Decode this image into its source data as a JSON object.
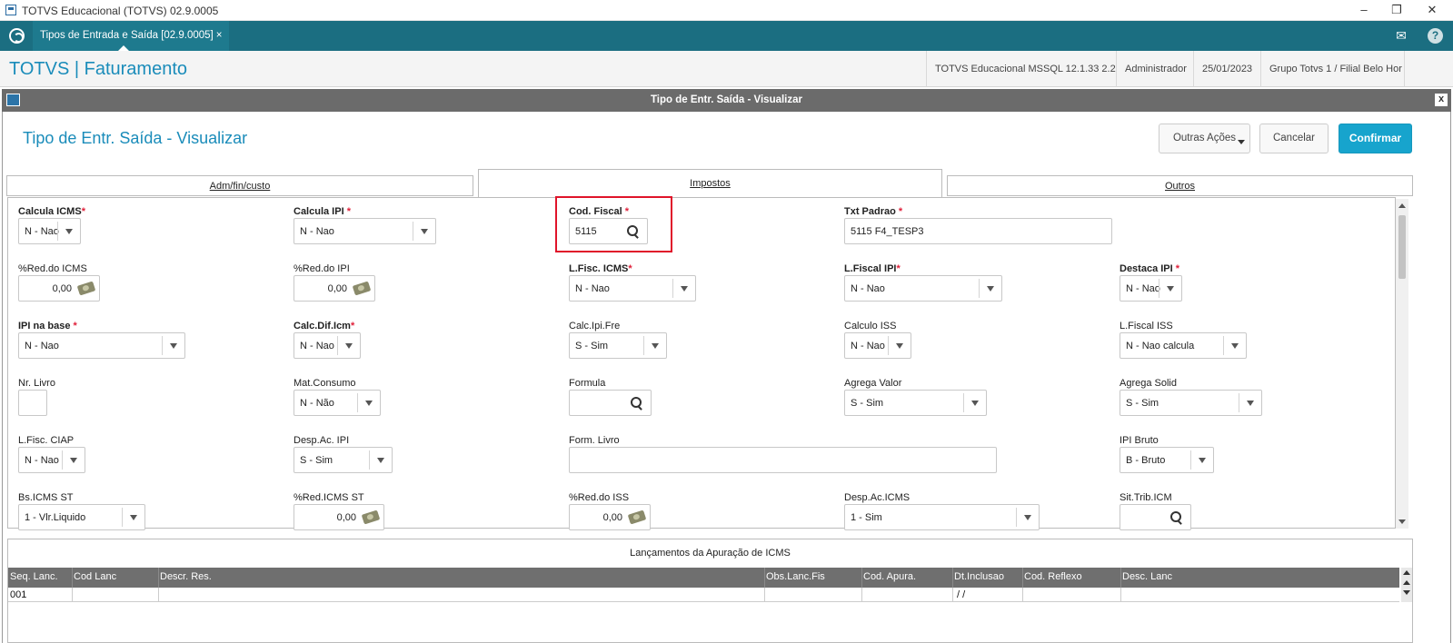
{
  "window": {
    "title": "TOTVS Educacional (TOTVS) 02.9.0005",
    "controls": [
      "–",
      "❐",
      "✕"
    ]
  },
  "tabbar": {
    "tab_label": "Tipos de Entrada e Saída [02.9.0005]",
    "tab_close": "×",
    "mail_icon": "✉",
    "help_icon": "?"
  },
  "app_header": {
    "title": "TOTVS | Faturamento",
    "environment": "TOTVS Educacional MSSQL 12.1.33 2.2",
    "user": "Administrador",
    "date": "25/01/2023",
    "branch": "Grupo Totvs 1 / Filial Belo Hor"
  },
  "dialog": {
    "title": "Tipo de Entr. Saída - Visualizar",
    "close": "x",
    "page_title": "Tipo de Entr. Saída - Visualizar",
    "buttons": {
      "other_actions": "Outras Ações",
      "cancel": "Cancelar",
      "confirm": "Confirmar"
    },
    "tabs": [
      "Adm/fin/custo",
      "Impostos",
      "Outros"
    ],
    "active_tab": "Impostos"
  },
  "fields": {
    "calcula_icms": {
      "label": "Calcula ICMS",
      "req": "*",
      "value": "N - Nao"
    },
    "calcula_ipi": {
      "label": "Calcula IPI",
      "req": " *",
      "value": "N - Nao"
    },
    "cod_fiscal": {
      "label": "Cod. Fiscal",
      "req": " *",
      "value": "5115"
    },
    "txt_padrao": {
      "label": "Txt Padrao",
      "req": " *",
      "value": "5115 F4_TESP3"
    },
    "red_icms": {
      "label": "%Red.do ICMS",
      "value": "0,00"
    },
    "red_ipi": {
      "label": "%Red.do IPI",
      "value": "0,00"
    },
    "lfisc_icms": {
      "label": "L.Fisc. ICMS",
      "req": "*",
      "value": "N - Nao"
    },
    "lfiscal_ipi": {
      "label": "L.Fiscal IPI",
      "req": "*",
      "value": "N - Nao"
    },
    "destaca_ipi": {
      "label": "Destaca IPI",
      "req": " *",
      "value": "N - Nao"
    },
    "ipi_na_base": {
      "label": "IPI na base",
      "req": " *",
      "value": "N - Nao"
    },
    "calc_dif_icm": {
      "label": "Calc.Dif.Icm",
      "req": "*",
      "value": "N - Nao"
    },
    "calc_ipi_fre": {
      "label": "Calc.Ipi.Fre",
      "value": "S - Sim"
    },
    "calculo_iss": {
      "label": "Calculo ISS",
      "value": "N - Nao"
    },
    "lfiscal_iss": {
      "label": "L.Fiscal ISS",
      "value": "N - Nao calcula"
    },
    "nr_livro": {
      "label": "Nr. Livro",
      "value": ""
    },
    "mat_consumo": {
      "label": "Mat.Consumo",
      "value": "N - Não"
    },
    "formula": {
      "label": "Formula",
      "value": ""
    },
    "agrega_valor": {
      "label": "Agrega Valor",
      "value": "S - Sim"
    },
    "agrega_solid": {
      "label": "Agrega Solid",
      "value": "S - Sim"
    },
    "lfisc_ciap": {
      "label": "L.Fisc. CIAP",
      "value": "N - Nao"
    },
    "desp_ac_ipi": {
      "label": "Desp.Ac. IPI",
      "value": "S - Sim"
    },
    "form_livro": {
      "label": "Form. Livro",
      "value": ""
    },
    "ipi_bruto": {
      "label": "IPI Bruto",
      "value": "B - Bruto"
    },
    "bs_icms_st": {
      "label": "Bs.ICMS ST",
      "value": "1 - Vlr.Liquido"
    },
    "red_icms_st": {
      "label": "%Red.ICMS ST",
      "value": "0,00"
    },
    "red_iss": {
      "label": "%Red.do ISS",
      "value": "0,00"
    },
    "desp_ac_icms": {
      "label": "Desp.Ac.ICMS",
      "value": "1 - Sim"
    },
    "sit_trib_icm": {
      "label": "Sit.Trib.ICM",
      "value": ""
    }
  },
  "grid": {
    "title": "Lançamentos da Apuração de ICMS",
    "columns": [
      "Seq. Lanc.",
      "Cod Lanc",
      "Descr. Res.",
      "Obs.Lanc.Fis",
      "Cod. Apura.",
      "Dt.Inclusao",
      "Cod. Reflexo",
      "Desc. Lanc"
    ],
    "rows": [
      [
        "001",
        "",
        "",
        "",
        "",
        " / /",
        "",
        ""
      ]
    ]
  },
  "colors": {
    "accent": "#1a8cba",
    "tabbar": "#1b6e81",
    "primary_button": "#17a4cd",
    "required": "#e0203a",
    "highlight_box": "#e0142a"
  }
}
